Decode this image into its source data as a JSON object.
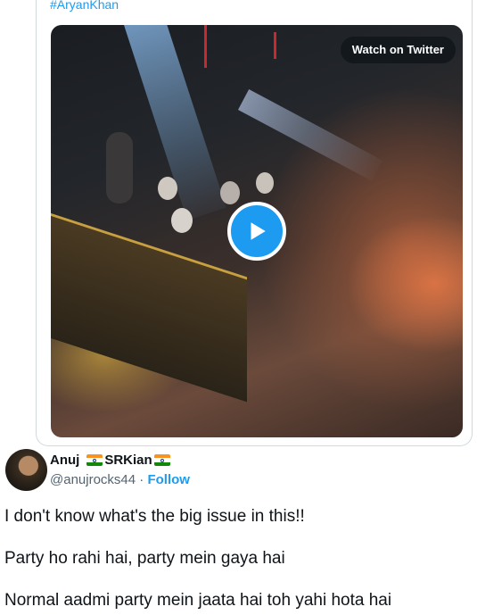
{
  "quoted_tweet": {
    "hashtag": "#AryanKhan",
    "video": {
      "watch_label": "Watch on Twitter",
      "play_icon": "play-icon"
    }
  },
  "reply": {
    "author": {
      "name": "Anuj",
      "name_suffix": "SRKian",
      "handle": "@anujrocks44",
      "separator": "·",
      "follow_label": "Follow"
    },
    "lines": [
      "I don't know what's the big issue in this!!",
      "Party ho rahi hai, party mein gaya hai",
      "Normal aadmi party mein jaata hai toh yahi hota hai"
    ]
  },
  "colors": {
    "link": "#1d9bf0",
    "secondary_text": "#536471",
    "border": "#cfd9de"
  }
}
